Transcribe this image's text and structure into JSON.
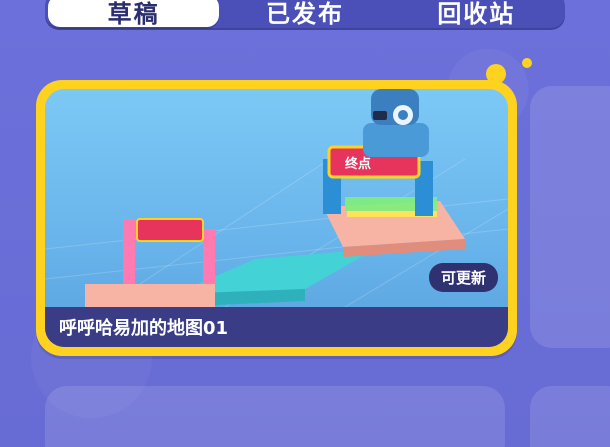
{
  "tabs": [
    {
      "label": "草稿",
      "active": true
    },
    {
      "label": "已发布",
      "active": false
    },
    {
      "label": "回收站",
      "active": false
    }
  ],
  "card": {
    "badge": "可更新",
    "map_title": "呼呼哈易加的地图01",
    "sign_text": "终点"
  },
  "colors": {
    "background": "#6b6fd8",
    "card_border": "#ffd21f",
    "tab_bar": "#4b4fb8",
    "caption_bar": "#3a3c86"
  }
}
